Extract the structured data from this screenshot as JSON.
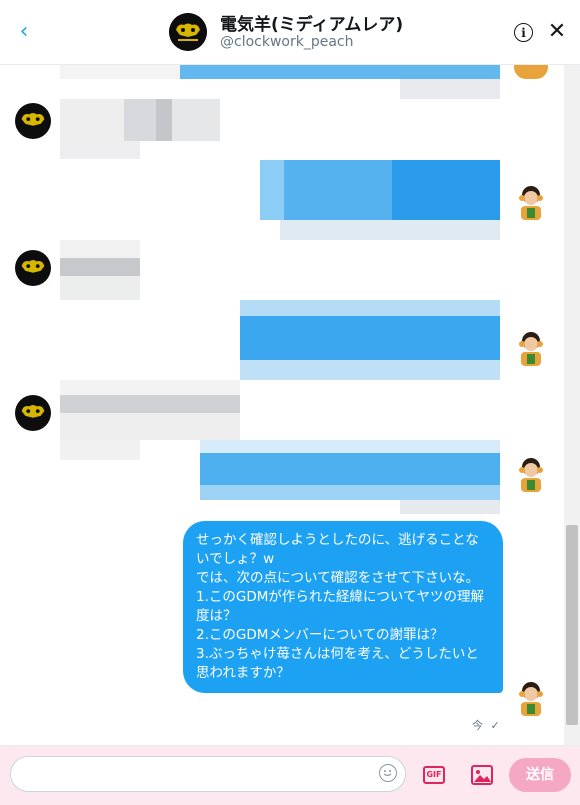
{
  "header": {
    "title": "電気羊(ミディアムレア)",
    "handle": "@clockwork_peach",
    "back_glyph": "‹",
    "info_glyph": "i",
    "close_glyph": "✕"
  },
  "message": {
    "lines": [
      "せっかく確認しようとしたのに、逃げることないでしょ？w",
      "では、次の点について確認をさせて下さいな。",
      "",
      "1.このGDMが作られた経緯についてヤツの理解度は？",
      "2.このGDMメンバーについての謝罪は？",
      "3.ぶっちゃけ苺さんは何を考え、どうしたいと思われますか？"
    ],
    "time": "今",
    "read_mark": "✓"
  },
  "composer": {
    "placeholder": "",
    "gif_label": "GIF",
    "send_label": "送信"
  },
  "colors": {
    "accent": "#1da1f2",
    "send_disabled": "#f5a8c3",
    "composer_bg": "#fce8ee",
    "icon_pink": "#e0245e"
  },
  "icons": [
    "back-arrow-icon",
    "info-icon",
    "close-icon",
    "emoji-icon",
    "gif-icon",
    "image-icon"
  ]
}
